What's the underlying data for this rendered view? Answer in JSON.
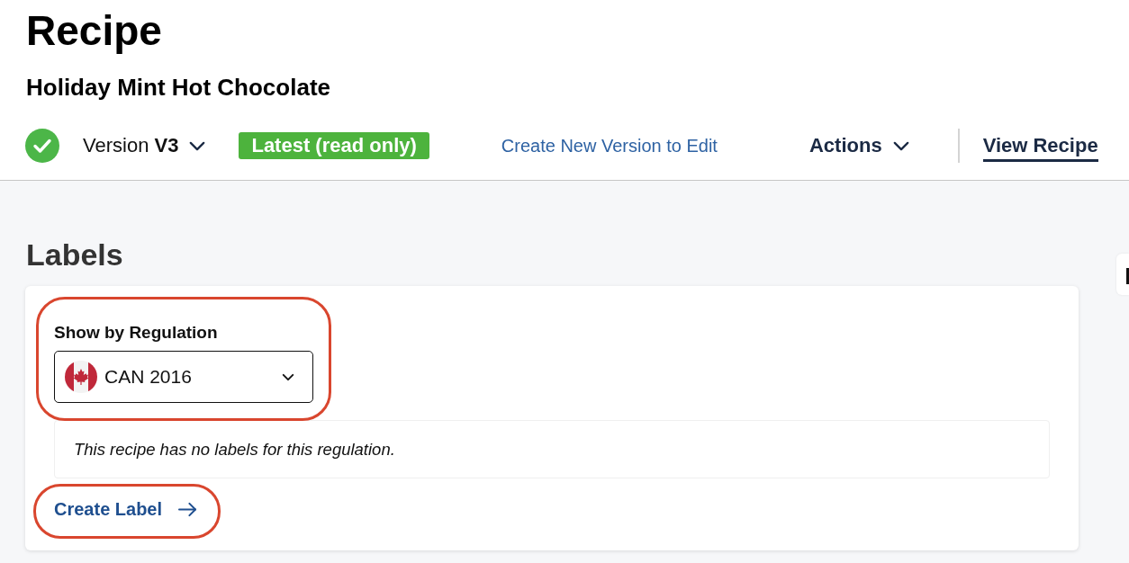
{
  "header": {
    "title": "Recipe",
    "subtitle": "Holiday Mint Hot Chocolate"
  },
  "toolbar": {
    "version": {
      "verified": true,
      "label": "Version",
      "value": "V3",
      "expanded": false
    },
    "status_badge": "Latest (read only)",
    "create_version_link": "Create New Version to Edit",
    "actions_menu": {
      "label": "Actions",
      "expanded": false
    },
    "view_recipe_link": {
      "label": "View Recipe",
      "selected": true
    }
  },
  "labels": {
    "heading": "Labels",
    "regulation_filter": {
      "label": "Show by Regulation",
      "value": "CAN 2016",
      "highlighted": true
    },
    "empty_message": "This recipe has no labels for this regulation.",
    "create_label_link": {
      "label": "Create Label",
      "highlighted": true
    }
  }
}
